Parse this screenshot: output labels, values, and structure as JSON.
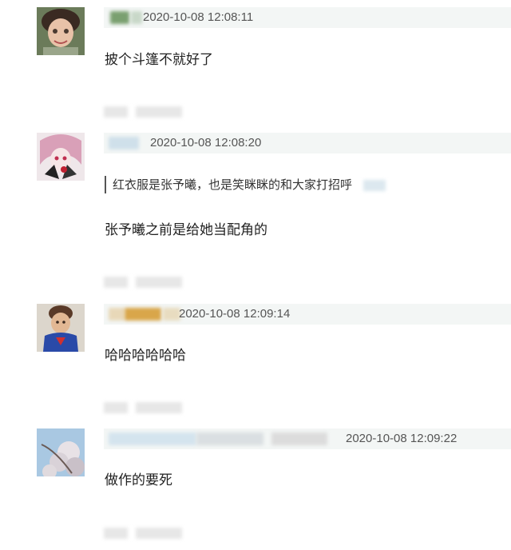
{
  "comments": [
    {
      "timestamp": "2020-10-08 12:08:11",
      "text": "披个斗篷不就好了"
    },
    {
      "timestamp": "2020-10-08 12:08:20",
      "quote": "红衣服是张予曦，也是笑眯眯的和大家打招呼",
      "text": "张予曦之前是给她当配角的"
    },
    {
      "timestamp": "2020-10-08 12:09:14",
      "text": "哈哈哈哈哈哈"
    },
    {
      "timestamp": "2020-10-08 12:09:22",
      "text": "做作的要死"
    }
  ],
  "colors": {
    "meta_bar": "#f3f6f5",
    "text": "#222222",
    "timestamp": "#555555"
  }
}
